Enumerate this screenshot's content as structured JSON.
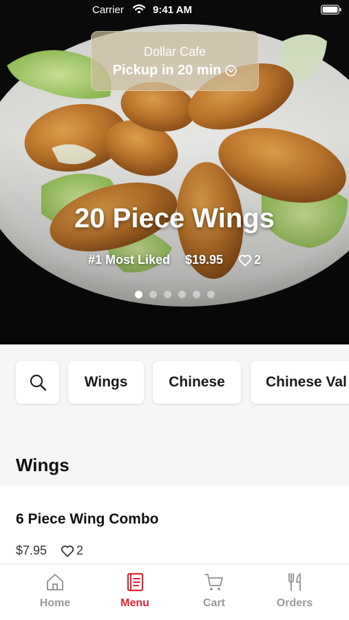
{
  "status_bar": {
    "carrier": "Carrier",
    "time": "9:41 AM"
  },
  "store": {
    "name": "Dollar Cafe",
    "pickup": "Pickup in 20 min"
  },
  "hero": {
    "title": "20 Piece Wings",
    "badge": "#1 Most Liked",
    "price": "$19.95",
    "likes": "2",
    "carousel": {
      "count": 6,
      "active_index": 0
    }
  },
  "categories": [
    {
      "label": "Wings"
    },
    {
      "label": "Chinese"
    },
    {
      "label": "Chinese Val"
    }
  ],
  "section": {
    "title": "Wings"
  },
  "item": {
    "name": "6 Piece Wing Combo",
    "price": "$7.95",
    "likes": "2"
  },
  "tabs": [
    {
      "label": "Home",
      "icon": "home-icon"
    },
    {
      "label": "Menu",
      "icon": "menu-book-icon",
      "active": true
    },
    {
      "label": "Cart",
      "icon": "cart-icon"
    },
    {
      "label": "Orders",
      "icon": "fork-knife-icon"
    }
  ],
  "colors": {
    "accent": "#e0242f",
    "inactive": "#9a9a9a",
    "background": "#f6f6f6"
  }
}
